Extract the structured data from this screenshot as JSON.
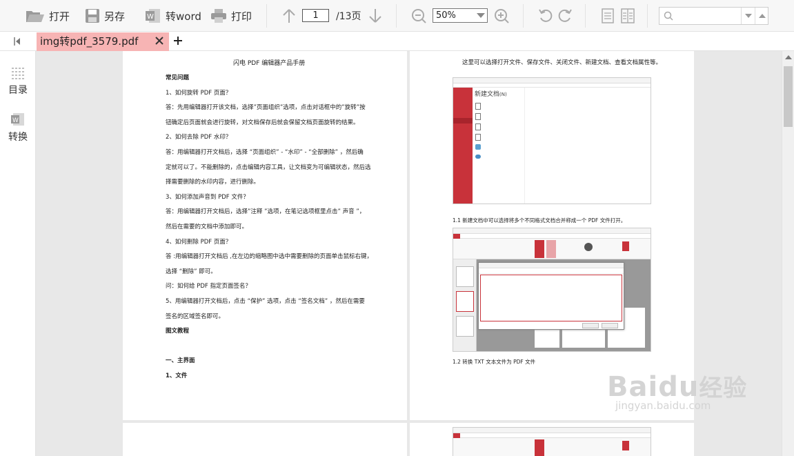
{
  "toolbar": {
    "open_label": "打开",
    "save_as_label": "另存",
    "to_word_label": "转word",
    "print_label": "打印",
    "current_page": "1",
    "total_pages": "/13页",
    "zoom": "50%",
    "search_placeholder": ""
  },
  "tab": {
    "file_name": "img转pdf_3579.pdf"
  },
  "sidebar": {
    "toc_label": "目录",
    "convert_label": "转换"
  },
  "page_left": {
    "title": "闪电 PDF 编辑器产品手册",
    "lines": [
      {
        "text": "常见问题",
        "bold": true
      },
      {
        "text": "1、如何旋转 PDF 页面？",
        "bold": false
      },
      {
        "text": "答：先用编辑器打开该文档，选择”页面组织”选项，点击对话框中的”旋转”按",
        "bold": false
      },
      {
        "text": "钮确定后页面就会进行旋转，对文档保存后就会保留文档页面旋转的结果。",
        "bold": false
      },
      {
        "text": "2、如何去除 PDF 水印？",
        "bold": false
      },
      {
        "text": "答：用编辑器打开文档后，选择 “页面组织” - “水印” - “全部删除” ，然后确",
        "bold": false
      },
      {
        "text": "定就可以了。不能删除的，点击编辑内容工具，让文档变为可编辑状态，然后选",
        "bold": false
      },
      {
        "text": "择需要删除的水印内容，进行删除。",
        "bold": false
      },
      {
        "text": "3、如何添加声音到 PDF 文件？",
        "bold": false
      },
      {
        "text": "答：用编辑器打开文档后，选择”注释 ”选项，在笔记选项框里点击” 声音 ”，",
        "bold": false
      },
      {
        "text": "然后在需要的文档中添加即可。",
        "bold": false
      },
      {
        "text": "4、如何删除 PDF 页面？",
        "bold": false
      },
      {
        "text": "答 :用编辑器打开文档后 ,在左边的缩略图中选中需要删除的页面单击鼠标右键，",
        "bold": false
      },
      {
        "text": "选择 “删除” 即可。",
        "bold": false
      },
      {
        "text": "问：如何给 PDF 指定页面签名？",
        "bold": false
      },
      {
        "text": "5、用编辑器打开文档后，点击 “保护” 选项，点击 “签名文档” ，然后在需要",
        "bold": false
      },
      {
        "text": "签名的区域签名即可。",
        "bold": false
      },
      {
        "text": "图文教程",
        "bold": true
      },
      {
        "text": "",
        "bold": false
      },
      {
        "text": "一、主界面",
        "bold": true
      },
      {
        "text": "1、文件",
        "bold": true
      }
    ]
  },
  "page_right": {
    "intro": "这里可以选择打开文件、保存文件、关闭文件、新建文档、查看文档属性等。",
    "caption_1": "1.1 新建文档中可以选择将多个不同格式文档合并称成一个 PDF 文件打开。",
    "caption_2": "1.2 转换 TXT 文本文件为 PDF 文件",
    "shot1_heading": "新建文档",
    "shot1_heading_suffix": "(N)"
  },
  "watermark": {
    "brand": "Baidu",
    "brand_cn": "经验",
    "url": "jingyan.baidu.com"
  },
  "colors": {
    "tab_bg": "#f7b4b4",
    "app_red": "#c8323a",
    "viewer_bg": "#e8e8e8"
  }
}
